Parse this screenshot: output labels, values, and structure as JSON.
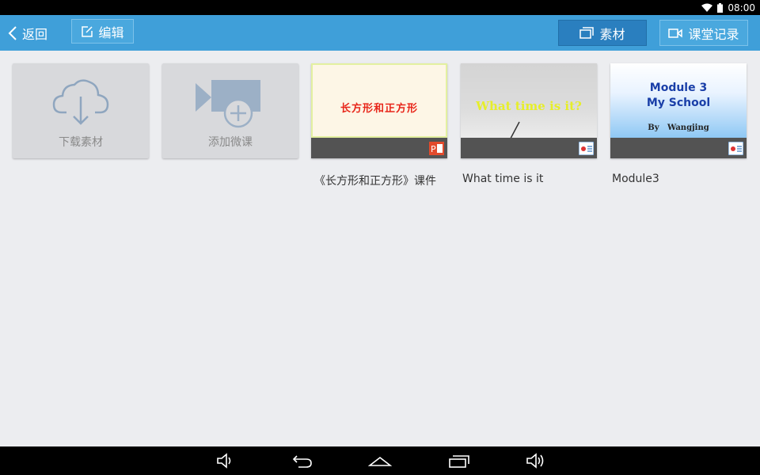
{
  "status_bar": {
    "time": "08:00",
    "icons": [
      "wifi-icon",
      "battery-icon"
    ]
  },
  "app_bar": {
    "back_label": "返回",
    "edit_label": "编辑",
    "tabs": [
      {
        "label": "素材",
        "icon": "material-icon",
        "selected": true
      },
      {
        "label": "课堂记录",
        "icon": "video-camera-icon",
        "selected": false
      }
    ]
  },
  "actions": [
    {
      "label": "下载素材",
      "icon": "cloud-download-icon"
    },
    {
      "label": "添加微课",
      "icon": "add-video-icon"
    }
  ],
  "materials": [
    {
      "caption": "《长方形和正方形》课件",
      "thumb_title": "长方形和正方形",
      "file_icon": "powerpoint-icon"
    },
    {
      "caption": "What time is it",
      "thumb_title": "What time is it?",
      "file_icon": "presentation-icon"
    },
    {
      "caption": "Module3",
      "thumb_title": "Module 3",
      "thumb_subtitle": "My School",
      "thumb_author": "By   Wangjing",
      "file_icon": "presentation-icon"
    }
  ],
  "nav_bar": {
    "buttons": [
      "volume-down-icon",
      "back-icon",
      "home-icon",
      "recent-apps-icon",
      "volume-up-icon"
    ]
  },
  "colors": {
    "app_bar": "#3f9fd9",
    "selected_tab": "#2a7fbf",
    "background": "#ecedf0",
    "tile": "#d8d9dc"
  }
}
